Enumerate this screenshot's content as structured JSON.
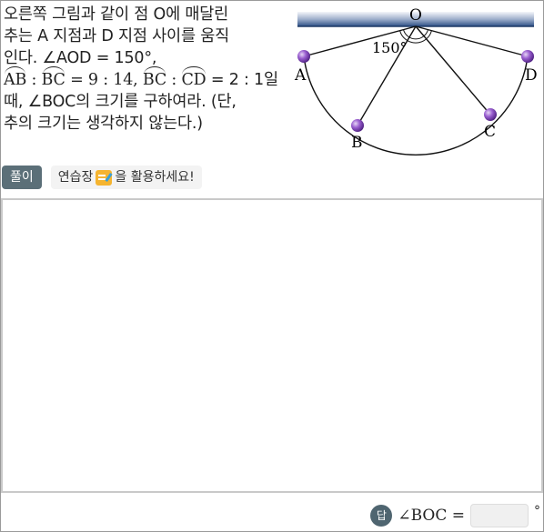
{
  "problem": {
    "line1": "오른쪽 그림과 같이 점 O에 매달린",
    "line2": "추는 A 지점과 D 지점 사이를 움직",
    "line3": "인다. ∠AOD = 150°,",
    "line4_arc_ab": "AB",
    "line4_sep1": " : ",
    "line4_arc_bc": "BC",
    "line4_ratio1": " = 9 : 14, ",
    "line4_arc_bc2": "BC",
    "line4_sep2": " : ",
    "line4_arc_cd": "CD",
    "line4_ratio2": " = 2 : 1일",
    "line5": "때, ∠BOC의 크기를 구하여라. (단,",
    "line6": "추의 크기는 생각하지 않는다.)"
  },
  "figure": {
    "label_o": "O",
    "label_a": "A",
    "label_b": "B",
    "label_c": "C",
    "label_d": "D",
    "angle_label": "150°",
    "colors": {
      "ceiling": "#2d4f86",
      "bob": "#7a3fb0"
    }
  },
  "toolbar": {
    "solve_label": "풀이",
    "practice_label_pre": "연습장",
    "practice_label_post": "을 활용하세요!",
    "practice_icon": "notepad-icon"
  },
  "answer": {
    "badge": "답",
    "label": "∠BOC =",
    "value": "",
    "unit": "°"
  }
}
